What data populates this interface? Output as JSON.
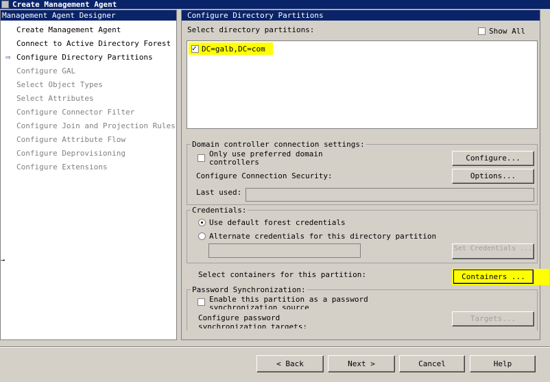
{
  "window": {
    "title": "Create Management Agent"
  },
  "left": {
    "header": "Management Agent Designer",
    "items": [
      {
        "label": "Create Management Agent"
      },
      {
        "label": "Connect to Active Directory Forest"
      },
      {
        "label": "Configure Directory Partitions"
      },
      {
        "label": "Configure GAL"
      },
      {
        "label": "Select Object Types"
      },
      {
        "label": "Select Attributes"
      },
      {
        "label": "Configure Connector Filter"
      },
      {
        "label": "Configure Join and Projection Rules"
      },
      {
        "label": "Configure Attribute Flow"
      },
      {
        "label": "Configure Deprovisioning"
      },
      {
        "label": "Configure Extensions"
      }
    ]
  },
  "right": {
    "header": "Configure Directory Partitions",
    "select_label": "Select directory partitions:",
    "show_all": "Show All",
    "partition": "DC=galb,DC=com",
    "dc": {
      "legend": "Domain controller connection settings:",
      "only_preferred": "Only use preferred domain controllers",
      "configure_btn": "Configure...",
      "security_label": "Configure Connection Security:",
      "options_btn": "Options...",
      "last_used_label": "Last used:"
    },
    "cred": {
      "legend": "Credentials:",
      "default": "Use default forest credentials",
      "alternate": "Alternate credentials for this directory partition",
      "set_btn": "Set Credentials ..."
    },
    "containers_label": "Select containers for this partition:",
    "containers_btn": "Containers ...",
    "pw": {
      "legend": "Password Synchronization:",
      "enable": "Enable this partition as a password synchronization source",
      "config_label": "Configure password synchronization targets:",
      "targets_btn": "Targets..."
    }
  },
  "footer": {
    "back": "< Back",
    "next": "Next >",
    "cancel": "Cancel",
    "help": "Help"
  },
  "colors": {
    "highlight": "#ffff00",
    "titlebar": "#0a246a"
  }
}
